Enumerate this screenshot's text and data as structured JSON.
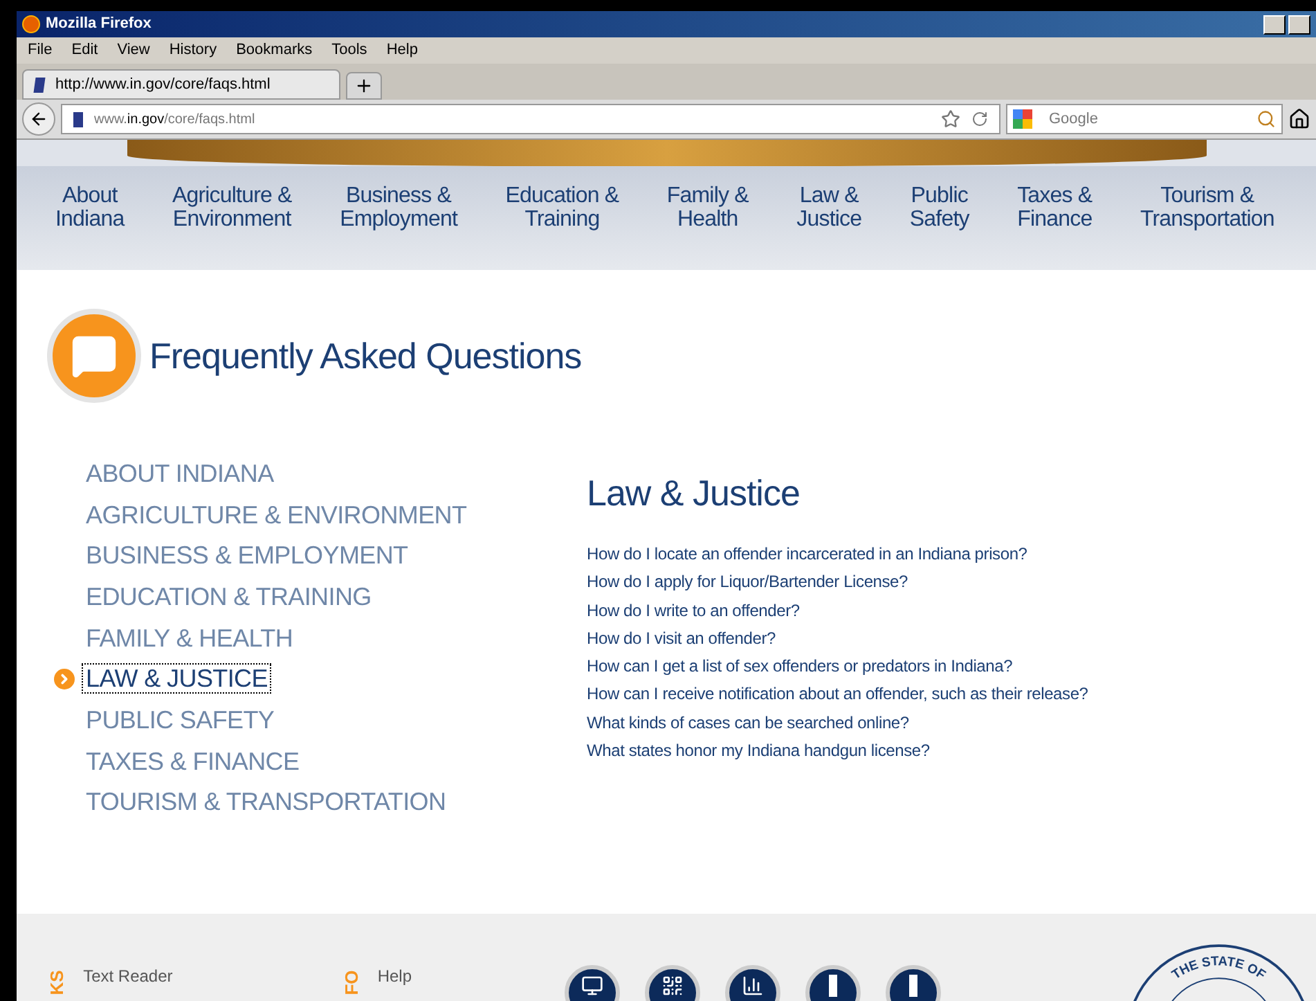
{
  "window": {
    "title": "Mozilla Firefox"
  },
  "menu": [
    "File",
    "Edit",
    "View",
    "History",
    "Bookmarks",
    "Tools",
    "Help"
  ],
  "tab": {
    "title": "http://www.in.gov/core/faqs.html",
    "selected": true
  },
  "address": {
    "host_prefix": "www.",
    "host": "in.gov",
    "path": "/core/faqs.html"
  },
  "search": {
    "placeholder": "Google"
  },
  "top_nav": [
    {
      "line1": "About",
      "line2": "Indiana"
    },
    {
      "line1": "Agriculture &",
      "line2": "Environment"
    },
    {
      "line1": "Business &",
      "line2": "Employment"
    },
    {
      "line1": "Education &",
      "line2": "Training"
    },
    {
      "line1": "Family &",
      "line2": "Health"
    },
    {
      "line1": "Law &",
      "line2": "Justice"
    },
    {
      "line1": "Public",
      "line2": "Safety"
    },
    {
      "line1": "Taxes &",
      "line2": "Finance"
    },
    {
      "line1": "Tourism &",
      "line2": "Transportation"
    }
  ],
  "page_title": "Frequently Asked Questions",
  "categories": [
    {
      "label": "ABOUT INDIANA",
      "selected": false
    },
    {
      "label": "AGRICULTURE & ENVIRONMENT",
      "selected": false
    },
    {
      "label": "BUSINESS & EMPLOYMENT",
      "selected": false
    },
    {
      "label": "EDUCATION & TRAINING",
      "selected": false
    },
    {
      "label": "FAMILY & HEALTH",
      "selected": false
    },
    {
      "label": "LAW & JUSTICE",
      "selected": true
    },
    {
      "label": "PUBLIC SAFETY",
      "selected": false
    },
    {
      "label": "TAXES & FINANCE",
      "selected": false
    },
    {
      "label": "TOURISM & TRANSPORTATION",
      "selected": false
    }
  ],
  "section_heading": "Law & Justice",
  "questions": [
    "How do I locate an offender incarcerated in an Indiana prison?",
    "How do I apply for Liquor/Bartender License?",
    "How do I write to an offender?",
    "How do I visit an offender?",
    "How can I get a list of sex offenders or predators in Indiana?",
    "How can I receive notification about an offender, such as their release?",
    "What kinds of cases can be searched online?",
    "What states honor my Indiana handgun license?"
  ],
  "footer": {
    "columns": [
      {
        "heading": "KS",
        "link": "Text Reader"
      },
      {
        "heading": "FO",
        "link": "Help"
      }
    ],
    "seal_text": "THE STATE OF"
  }
}
